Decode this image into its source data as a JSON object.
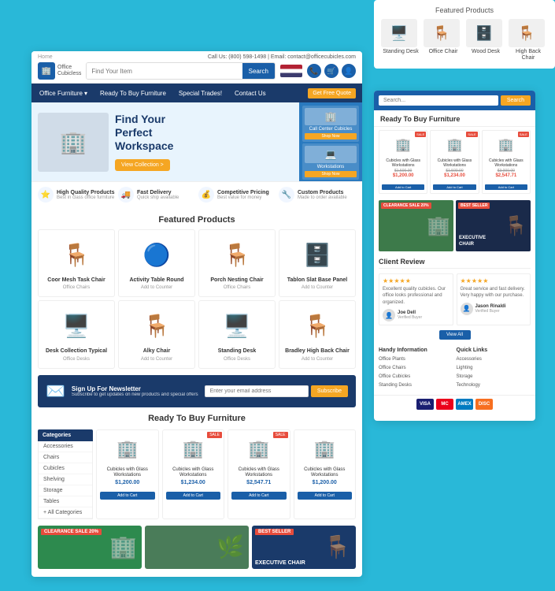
{
  "page": {
    "title": "Office Cubicles"
  },
  "bg_card": {
    "title": "Featured Products",
    "products": [
      {
        "name": "Standing Desk",
        "emoji": "🖥️"
      },
      {
        "name": "Office Chair",
        "emoji": "🪑"
      },
      {
        "name": "Wood Desk",
        "emoji": "🗄️"
      },
      {
        "name": "High Back Chair",
        "emoji": "🪑"
      }
    ]
  },
  "header": {
    "top_left": "Home",
    "top_right": "Call Us: (800) 598-1498 | Email: contact@officecubicles.com",
    "logo_line1": "Office",
    "logo_line2": "Cubicless",
    "search_placeholder": "Find Your Item",
    "search_btn": "Search",
    "icon_cart": "🛒",
    "icon_user": "👤",
    "icon_phone": "📞"
  },
  "navbar": {
    "items": [
      {
        "label": "Office Furniture",
        "has_dropdown": true
      },
      {
        "label": "Ready To Buy Furniture",
        "has_dropdown": false
      },
      {
        "label": "Special Trades!",
        "has_dropdown": false
      },
      {
        "label": "Contact Us",
        "has_dropdown": false
      }
    ],
    "quote_btn": "Get Free Quote"
  },
  "hero": {
    "headline_line1": "Find Your",
    "headline_line2": "Perfect",
    "headline_line3": "Workspace",
    "btn_label": "View Collection >",
    "right_cards": [
      {
        "name": "Call Center Cubicles",
        "btn": "Shop Now",
        "emoji": "🏢"
      },
      {
        "name": "Workstations",
        "btn": "Shop Now",
        "emoji": "💻"
      }
    ]
  },
  "features": [
    {
      "icon": "⭐",
      "title": "High Quality Products",
      "sub": "Best in class office furniture"
    },
    {
      "icon": "🚚",
      "title": "Fast Delivery",
      "sub": "Quick ship available"
    },
    {
      "icon": "💰",
      "title": "Competitive Pricing",
      "sub": "Best value for money"
    },
    {
      "icon": "🔧",
      "title": "Custom Products",
      "sub": "Made to order available"
    }
  ],
  "featured_products": {
    "title": "Featured Products",
    "items": [
      {
        "name": "Coor Mesh Task Chair",
        "brand": "Office Chairs",
        "price": "",
        "emoji": "🪑"
      },
      {
        "name": "Activity Table Round",
        "brand": "Add to Counter",
        "price": "",
        "emoji": "⭕"
      },
      {
        "name": "Porch Nesting Chair",
        "brand": "Office Chairs",
        "price": "",
        "emoji": "🪑"
      },
      {
        "name": "Tablon Slat Base Panel",
        "brand": "Add to Counter",
        "price": "",
        "emoji": "🗄️"
      },
      {
        "name": "Desk Collection Typical",
        "brand": "Office Desks",
        "price": "",
        "emoji": "🖥️"
      },
      {
        "name": "Alky Chair",
        "brand": "Add to Counter",
        "price": "",
        "emoji": "🪑"
      },
      {
        "name": "Standing Desk",
        "brand": "Office Desks",
        "price": "",
        "emoji": "🖥️"
      },
      {
        "name": "Bradley High Back Chair",
        "brand": "Add to Counter",
        "price": "",
        "emoji": "🪑"
      }
    ]
  },
  "newsletter": {
    "icon": "✉️",
    "title": "Sign Up For Newsletter",
    "sub": "Subscribe to get updates on new products and special offers",
    "placeholder": "Enter your email address",
    "btn": "Subscribe"
  },
  "ready_section": {
    "title": "Ready To Buy Furniture",
    "categories": {
      "header": "Categories",
      "items": [
        "Accessories",
        "Chairs",
        "Cubicles",
        "Shelving",
        "Storage",
        "Tables",
        "+ All Categories"
      ]
    },
    "products": [
      {
        "name": "Cubicles with Glass Workstations",
        "price": "$1,200.00",
        "badge": "",
        "emoji": "🏢"
      },
      {
        "name": "Cubicles with Glass Workstations",
        "price": "$1,234.00",
        "badge": "SALE",
        "emoji": "🏢"
      },
      {
        "name": "Cubicles with Glass Workstations",
        "price": "$2,547.71",
        "badge": "SALE",
        "emoji": "🏢"
      },
      {
        "name": "Cubicles with Glass Workstations",
        "price": "$1,200.00",
        "badge": "",
        "emoji": "🏢"
      }
    ]
  },
  "bottom_banners": [
    {
      "label": "CLEARANCE SALE 20%",
      "text": "",
      "emoji": "🏢",
      "bg": "#2d8a4e"
    },
    {
      "label": "",
      "text": "",
      "emoji": "🌿",
      "bg": "#4a7c59"
    },
    {
      "label": "BEST SELLER",
      "text": "EXECUTIVE CHAIR",
      "emoji": "🪑",
      "bg": "#1a3a6a"
    }
  ],
  "right_panel": {
    "search_placeholder": "Search...",
    "search_btn": "Search",
    "ready_title": "Ready To Buy Furniture",
    "products": [
      {
        "name": "Cubicles with Glass Workstations",
        "old_price": "$1,500.00",
        "price": "$1,200.00",
        "badge": "SALE",
        "emoji": "🏢"
      },
      {
        "name": "Cubicles with Glass Workstations",
        "old_price": "$1,500.00",
        "price": "$1,234.00",
        "badge": "SALE",
        "emoji": "🏢"
      },
      {
        "name": "Cubicles with Glass Workstations",
        "old_price": "$3,000.00",
        "price": "$2,547.71",
        "badge": "SALE",
        "emoji": "🏢"
      }
    ],
    "banners": [
      {
        "badge": "CLEARANCE SALE 20%",
        "text": "",
        "emoji": "🏢",
        "bg": "#3d7a4a"
      },
      {
        "badge": "BEST SELLER",
        "text": "EXECUTIVE CHAIR",
        "emoji": "🪑",
        "bg": "#1a2a4a"
      }
    ],
    "review_title": "Client Review",
    "reviews": [
      {
        "stars": "★★★★★",
        "text": "Excellent quality cubicles. Our office looks professional and organized.",
        "reviewer": "Joe Dell",
        "sub": "Verified Buyer"
      },
      {
        "stars": "★★★★★",
        "text": "Great service and fast delivery. Very happy with our purchase.",
        "reviewer": "Jason Rinaldi",
        "sub": "Verified Buyer"
      }
    ],
    "more_btn": "View All",
    "quick_links": {
      "col1_title": "Handy Information",
      "col1_items": [
        "Office Plants",
        "Office Chairs",
        "Office Cubicles",
        "Standing Desks"
      ],
      "col2_title": "Quick Links",
      "col2_items": [
        "Accessories",
        "Lighting",
        "Storage",
        "Technology"
      ]
    },
    "payments": [
      "VISA",
      "MC",
      "AMEX",
      "DISC"
    ]
  }
}
